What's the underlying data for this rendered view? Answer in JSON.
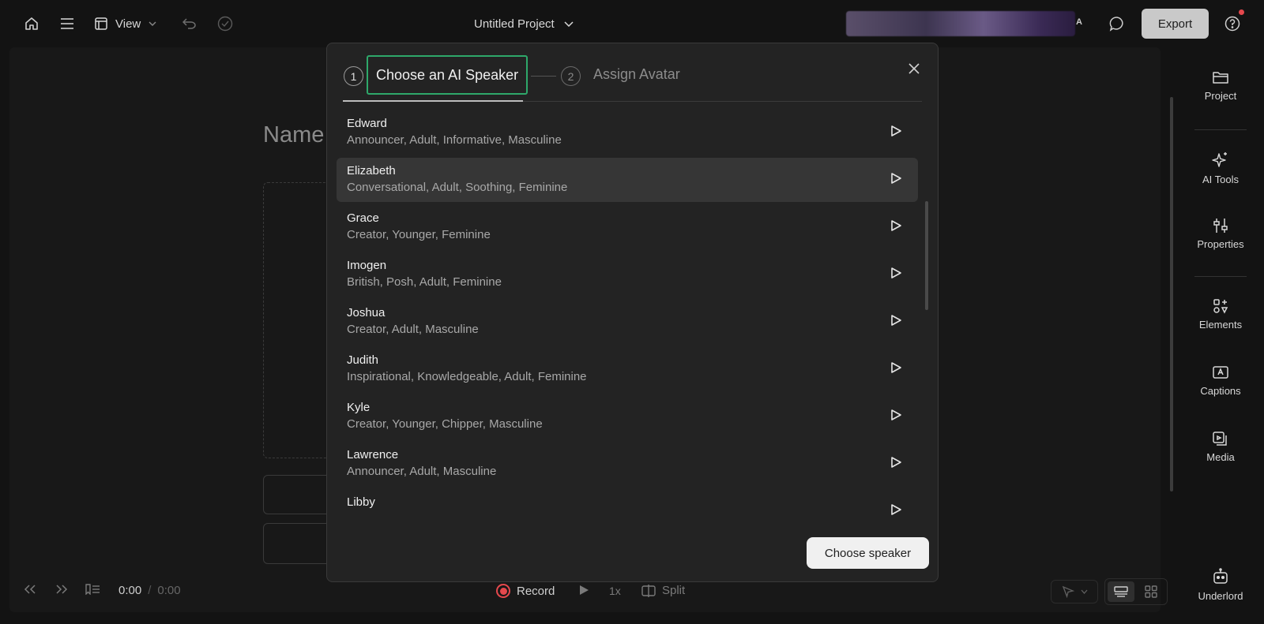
{
  "topbar": {
    "view_label": "View",
    "project_title": "Untitled Project",
    "account_initial": "A",
    "export_label": "Export"
  },
  "canvas": {
    "heading": "Name"
  },
  "bottombar": {
    "time_current": "0:00",
    "time_separator": "/",
    "time_total": "0:00",
    "record_label": "Record",
    "speed_label": "1x",
    "split_label": "Split"
  },
  "sidebar": {
    "items": [
      {
        "label": "Project",
        "icon": "folder-icon"
      },
      {
        "label": "AI Tools",
        "icon": "sparkle-icon"
      },
      {
        "label": "Properties",
        "icon": "sliders-icon"
      },
      {
        "label": "Elements",
        "icon": "shapes-icon"
      },
      {
        "label": "Captions",
        "icon": "captions-icon"
      },
      {
        "label": "Media",
        "icon": "media-icon"
      },
      {
        "label": "Underlord",
        "icon": "robot-icon"
      }
    ]
  },
  "modal": {
    "step1_num": "1",
    "step1_label": "Choose an AI Speaker",
    "step2_num": "2",
    "step2_label": "Assign Avatar",
    "choose_button": "Choose speaker",
    "selected_index": 1,
    "speakers": [
      {
        "name": "Edward",
        "tags": "Announcer, Adult, Informative, Masculine"
      },
      {
        "name": "Elizabeth",
        "tags": "Conversational, Adult, Soothing, Feminine"
      },
      {
        "name": "Grace",
        "tags": "Creator, Younger, Feminine"
      },
      {
        "name": "Imogen",
        "tags": "British, Posh, Adult, Feminine"
      },
      {
        "name": "Joshua",
        "tags": "Creator, Adult, Masculine"
      },
      {
        "name": "Judith",
        "tags": "Inspirational, Knowledgeable, Adult, Feminine"
      },
      {
        "name": "Kyle",
        "tags": "Creator, Younger, Chipper, Masculine"
      },
      {
        "name": "Lawrence",
        "tags": "Announcer, Adult, Masculine"
      },
      {
        "name": "Libby",
        "tags": ""
      }
    ]
  },
  "colors": {
    "accent_green": "#2ea86a",
    "record_red": "#e5484d",
    "modal_bg": "#232323",
    "app_bg": "#131313"
  }
}
